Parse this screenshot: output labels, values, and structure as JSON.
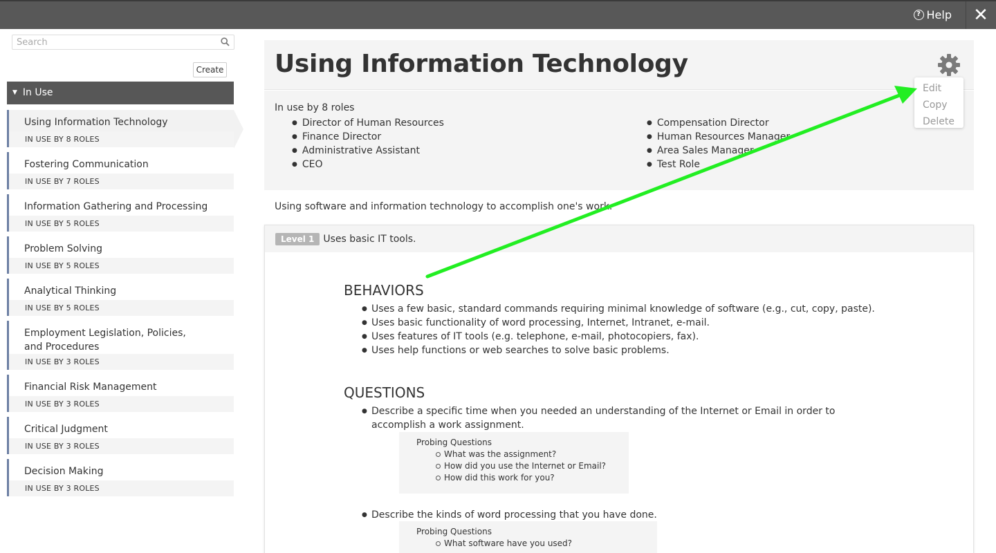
{
  "topbar": {
    "help_label": "Help"
  },
  "sidebar": {
    "search_placeholder": "Search",
    "create_label": "Create",
    "group_label": "In Use",
    "items": [
      {
        "name": "Using Information Technology",
        "count": "IN USE BY 8 ROLES"
      },
      {
        "name": "Fostering Communication",
        "count": "IN USE BY 7 ROLES"
      },
      {
        "name": "Information Gathering and Processing",
        "count": "IN USE BY 5 ROLES"
      },
      {
        "name": "Problem Solving",
        "count": "IN USE BY 5 ROLES"
      },
      {
        "name": "Analytical Thinking",
        "count": "IN USE BY 5 ROLES"
      },
      {
        "name": "Employment Legislation, Policies, and Procedures",
        "count": "IN USE BY 3 ROLES"
      },
      {
        "name": "Financial Risk Management",
        "count": "IN USE BY 3 ROLES"
      },
      {
        "name": "Critical Judgment",
        "count": "IN USE BY 3 ROLES"
      },
      {
        "name": "Decision Making",
        "count": "IN USE BY 3 ROLES"
      }
    ]
  },
  "main": {
    "title": "Using Information Technology",
    "menu": {
      "edit": "Edit",
      "copy": "Copy",
      "delete": "Delete"
    },
    "roles_label": "In use by 8 roles",
    "roles": [
      "Director of Human Resources",
      "Finance Director",
      "Administrative Assistant",
      "CEO",
      "Compensation Director",
      "Human Resources Manager",
      "Area Sales Manager",
      "Test Role"
    ],
    "description": "Using software and information technology to accomplish one's work.",
    "level": {
      "badge": "Level 1",
      "summary": "Uses basic IT tools.",
      "behaviors_title": "BEHAVIORS",
      "behaviors": [
        "Uses a few basic, standard commands requiring minimal knowledge of software (e.g., cut, copy, paste).",
        "Uses basic functionality of word processing, Internet, Intranet, e-mail.",
        "Uses features of IT tools (e.g. telephone, e-mail, photocopiers, fax).",
        "Uses help functions or web searches to solve basic problems."
      ],
      "questions_title": "QUESTIONS",
      "questions": [
        {
          "text": "Describe a specific time when you needed an understanding of the Internet or Email in order to accomplish a work assignment.",
          "probing_label": "Probing Questions",
          "probes": [
            "What was the assignment?",
            "How did you use the Internet or Email?",
            "How did this work for you?"
          ]
        },
        {
          "text": "Describe the kinds of word processing that you have done.",
          "probing_label": "Probing Questions",
          "probes": [
            "What software have you used?"
          ]
        }
      ]
    }
  },
  "colors": {
    "topbar": "#585858",
    "group_header": "#575757",
    "accent_border": "#6c7fa3",
    "annotation_arrow": "#22ee22"
  }
}
